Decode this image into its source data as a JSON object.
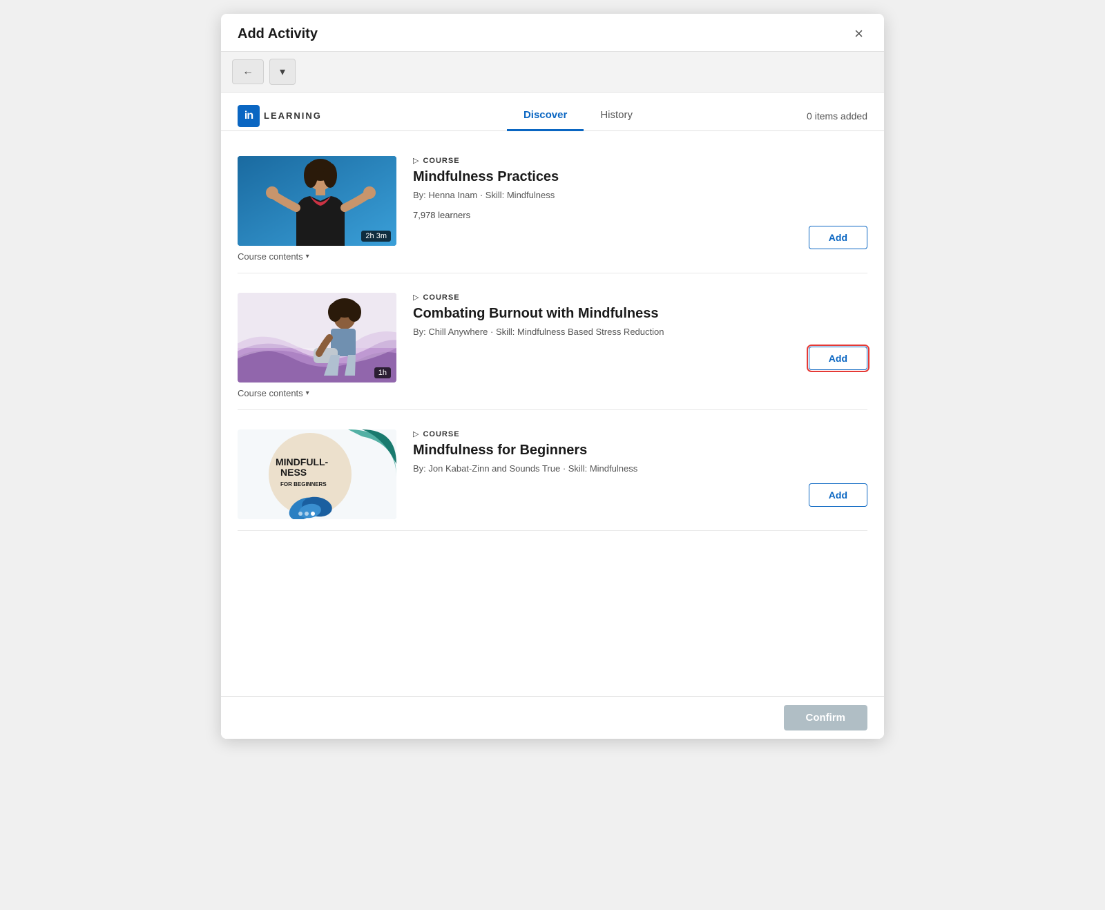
{
  "modal": {
    "title": "Add Activity",
    "close_label": "×"
  },
  "toolbar": {
    "back_label": "←",
    "dropdown_label": "▾"
  },
  "brand": {
    "logo": "in",
    "name": "LEARNING"
  },
  "nav": {
    "tabs": [
      {
        "id": "discover",
        "label": "Discover",
        "active": true
      },
      {
        "id": "history",
        "label": "History",
        "active": false
      }
    ],
    "items_added": "0 items added"
  },
  "courses": [
    {
      "id": "course-1",
      "type": "COURSE",
      "title": "Mindfulness Practices",
      "by": "By: Henna Inam",
      "skill": "Skill: Mindfulness",
      "learners": "7,978 learners",
      "duration": "2h 3m",
      "add_label": "Add",
      "contents_label": "Course contents",
      "focused": false
    },
    {
      "id": "course-2",
      "type": "COURSE",
      "title": "Combating Burnout with Mindfulness",
      "by": "By: Chill Anywhere",
      "skill": "Skill: Mindfulness Based Stress Reduction",
      "learners": "",
      "duration": "1h",
      "add_label": "Add",
      "contents_label": "Course contents",
      "focused": true
    },
    {
      "id": "course-3",
      "type": "COURSE",
      "title": "Mindfulness for Beginners",
      "by": "By: Jon Kabat-Zinn and Sounds True",
      "skill": "Skill: Mindfulness",
      "learners": "",
      "duration": "",
      "add_label": "Add",
      "contents_label": "",
      "focused": false
    }
  ],
  "footer": {
    "confirm_label": "Confirm"
  }
}
